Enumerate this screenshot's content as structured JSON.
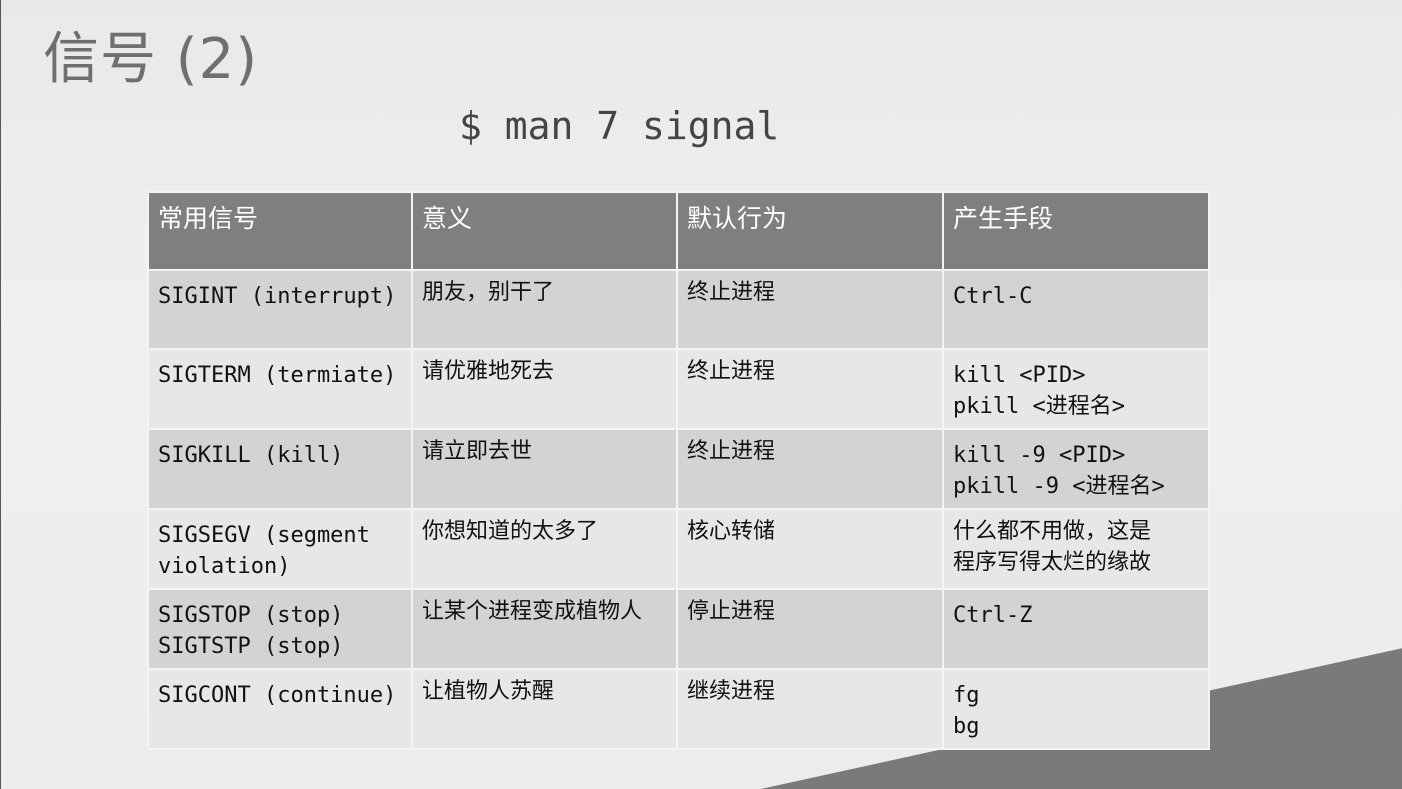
{
  "title": "信号 (2)",
  "command": "$ man 7 signal",
  "table": {
    "headers": [
      "常用信号",
      "意义",
      "默认行为",
      "产生手段"
    ],
    "rows": [
      {
        "signal": [
          "SIGINT (interrupt)"
        ],
        "meaning": "朋友，别干了",
        "default_action": "终止进程",
        "trigger": [
          "Ctrl-C"
        ]
      },
      {
        "signal": [
          "SIGTERM (termiate)"
        ],
        "meaning": "请优雅地死去",
        "default_action": "终止进程",
        "trigger": [
          "kill <PID>",
          "pkill <进程名>"
        ]
      },
      {
        "signal": [
          "SIGKILL (kill)"
        ],
        "meaning": "请立即去世",
        "default_action": "终止进程",
        "trigger": [
          "kill -9 <PID>",
          "pkill -9 <进程名>"
        ]
      },
      {
        "signal": [
          "SIGSEGV (segment",
          "violation)"
        ],
        "meaning": "你想知道的太多了",
        "default_action": "核心转储",
        "trigger": [
          "什么都不用做，这是",
          "程序写得太烂的缘故"
        ]
      },
      {
        "signal": [
          "SIGSTOP (stop)",
          "SIGTSTP (stop)"
        ],
        "meaning": "让某个进程变成植物人",
        "default_action": "停止进程",
        "trigger": [
          "Ctrl-Z"
        ]
      },
      {
        "signal": [
          "SIGCONT (continue)"
        ],
        "meaning": "让植物人苏醒",
        "default_action": "继续进程",
        "trigger": [
          "fg",
          "bg"
        ]
      }
    ]
  },
  "colors": {
    "header_bg": "#7f7f7f",
    "row_dark": "#d3d3d3",
    "row_light": "#e7e7e7",
    "title": "#6f6f6f",
    "corner_shape": "#7a7a7a"
  }
}
